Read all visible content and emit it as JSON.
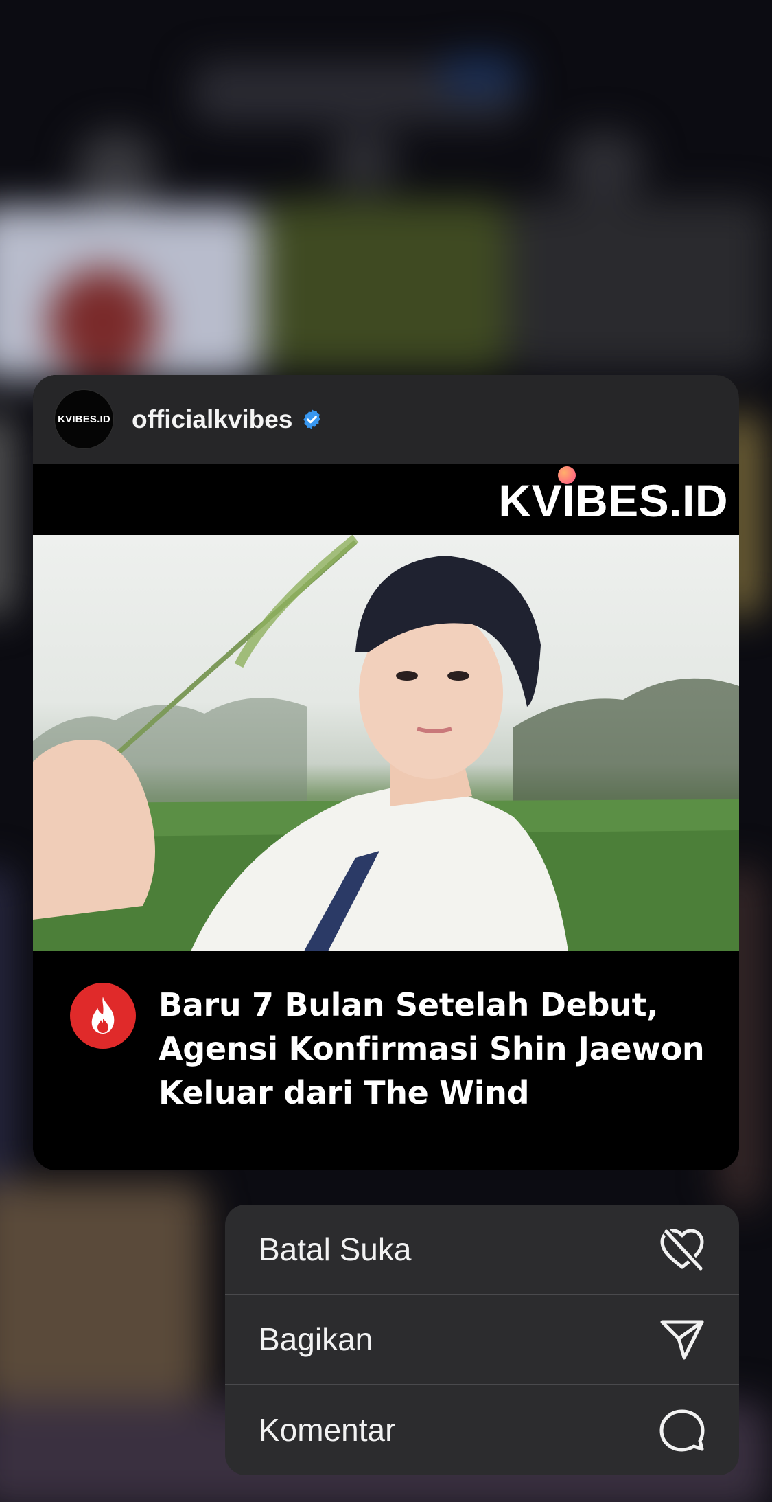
{
  "post": {
    "username": "officialkvibes",
    "avatar_text": "KVIBES.ID",
    "verified_icon": "verified-badge-icon",
    "brand_text": "KVIBES.ID",
    "headline_icon": "fire-icon",
    "headline": "Baru 7 Bulan Setelah Debut, Agensi Konfirmasi Shin Jaewon Keluar dari The Wind"
  },
  "menu": {
    "items": [
      {
        "label": "Batal Suka",
        "icon": "heart-slash-icon"
      },
      {
        "label": "Bagikan",
        "icon": "send-icon"
      },
      {
        "label": "Komentar",
        "icon": "comment-icon"
      }
    ]
  },
  "colors": {
    "verified": "#3897f0",
    "fire_badge": "#e02a2a",
    "menu_bg": "#2c2c2e",
    "card_header_bg": "#262628"
  }
}
